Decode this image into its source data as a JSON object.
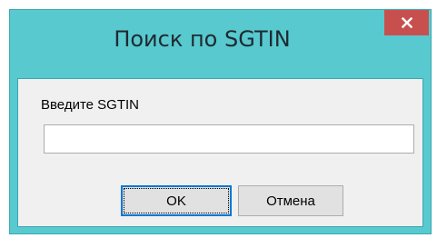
{
  "dialog": {
    "title": "Поиск по SGTIN",
    "close_glyph": "✕",
    "field_label": "Введите SGTIN",
    "field_value": "",
    "field_placeholder": "",
    "ok_label": "OK",
    "cancel_label": "Отмена"
  },
  "colors": {
    "titlebar": "#57c9cf",
    "close_button": "#c7504f",
    "client_bg": "#f0f0f0",
    "default_button_border": "#0078d7"
  },
  "icons": {
    "close": "close-icon"
  }
}
